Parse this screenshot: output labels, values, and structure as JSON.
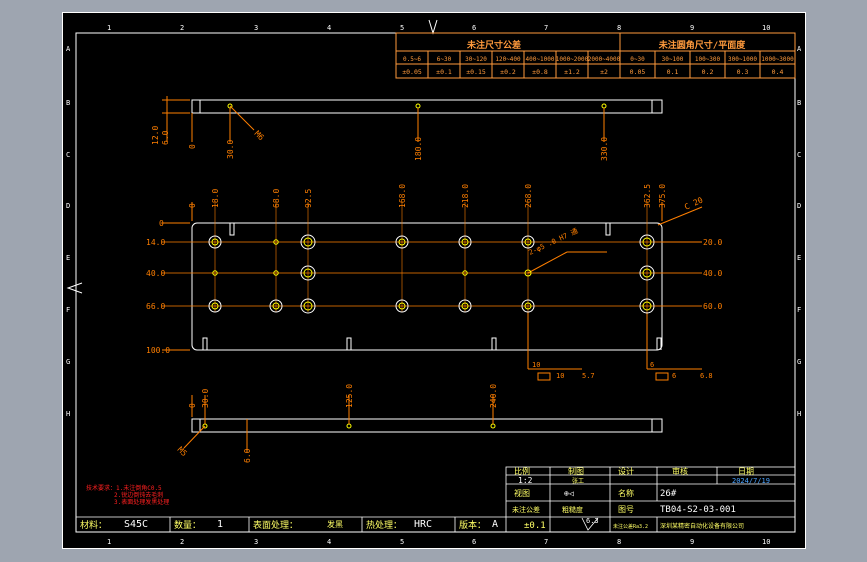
{
  "colors": {
    "line": "#ffffff",
    "dim": "#ff7f00",
    "title": "#ffff66",
    "note": "#ff2020",
    "table": "#ff9a3c"
  },
  "border": {
    "columns": [
      "1",
      "2",
      "3",
      "4",
      "5",
      "6",
      "7",
      "8",
      "9",
      "10"
    ],
    "rows": [
      "A",
      "B",
      "C",
      "D",
      "E",
      "F",
      "G",
      "H"
    ]
  },
  "tolerance_table": {
    "header_left": "未注尺寸公差",
    "header_right": "未注圆角尺寸/平面度",
    "ranges": [
      "0.5~6",
      "6~30",
      "30~120",
      "120~400",
      "400~1000",
      "1000~2000",
      "2000~4000",
      "0~30",
      "30~100",
      "100~300",
      "300~1000",
      "1000~3000"
    ],
    "values": [
      "±0.05",
      "±0.1",
      "±0.15",
      "±0.2",
      "±0.8",
      "±1.2",
      "±2",
      "0.05",
      "0.1",
      "0.2",
      "0.3",
      "0.4"
    ]
  },
  "top_view": {
    "dims": [
      "0",
      "30.0",
      "180.0",
      "330.0"
    ],
    "left_dims": [
      "12.0",
      "6.0"
    ],
    "hole_callout": "M6"
  },
  "main_view": {
    "top_dims": [
      "0",
      "18.0",
      "68.0",
      "92.5",
      "168.0",
      "218.0",
      "268.0",
      "362.5",
      "375.0"
    ],
    "left_dims": [
      "0",
      "14.0",
      "40.0",
      "66.0",
      "100.0"
    ],
    "right_dims": [
      "20.0",
      "40.0",
      "60.0"
    ],
    "radius": "C 20",
    "hole_note": "2-φ5 .0 H7 通",
    "bottom_callouts": [
      "10",
      "10",
      "5.7",
      "6",
      "6",
      "6.8"
    ]
  },
  "bottom_view": {
    "dims": [
      "0",
      "30.0",
      "125.0",
      "240.0"
    ],
    "left_dim": "6.0",
    "hole_callout": "M5"
  },
  "notes": {
    "lines": [
      "技术要求：1.未注倒角C0.5",
      "2.锐边倒钝去毛刺",
      "3.表面处理发黑处理"
    ]
  },
  "title_block": {
    "material_label": "材料：",
    "material": "S45C",
    "qty_label": "数量：",
    "qty": "1",
    "surface_label": "表面处理：",
    "surface": "发黑",
    "heat_label": "热处理：",
    "heat": "HRC",
    "rev_label": "版本：",
    "rev": "A",
    "scale_label": "比例",
    "scale": "1:2",
    "drawn_label": "制图",
    "designer": "张工",
    "check_label": "设计",
    "review_label": "审核",
    "date_label": "日期",
    "date": "2024/7/19",
    "proj_label": "视图",
    "proj_symbol": "⊕◁",
    "name_label": "名称",
    "name": "26#",
    "tol_label": "未注公差",
    "tol": "±0.1",
    "rough_label": "粗糙度",
    "rough": "6.3",
    "code_label": "图号",
    "code": "TB04-S2-03-001",
    "company": "深圳某精密自动化设备有限公司",
    "footer": "未注公差Ra3.2"
  }
}
